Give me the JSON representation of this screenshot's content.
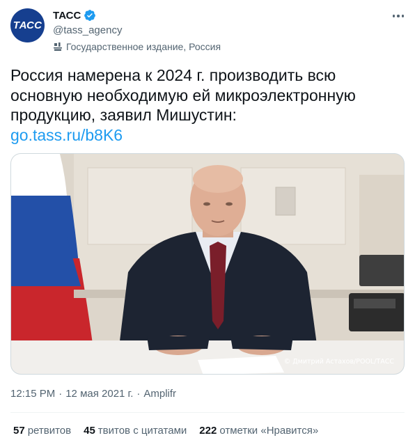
{
  "author": {
    "avatar_text": "ТАСС",
    "display_name": "ТАСС",
    "handle": "@tass_agency",
    "label": "Государственное издание, Россия",
    "verified": true
  },
  "icons": {
    "verified": "verified-badge-icon",
    "label": "state-media-icon",
    "more": "more-options-icon"
  },
  "tweet": {
    "text_lines": [
      "Россия намерена к 2024 г. производить всю",
      "основную необходимую ей микроэлектронную",
      "продукцию, заявил Мишустин:"
    ],
    "link": "go.tass.ru/b8K6",
    "photo_credit": "© Дмитрий Астахов/POOL/ТАСС"
  },
  "meta": {
    "time": "12:15 PM",
    "separator": "·",
    "date": "12 мая 2021 г.",
    "source": "Amplifr"
  },
  "stats": [
    {
      "count": "57",
      "label": "ретвитов"
    },
    {
      "count": "45",
      "label": "твитов с цитатами"
    },
    {
      "count": "222",
      "label": "отметки «Нравится»"
    }
  ],
  "colors": {
    "accent": "#1d9bf0",
    "avatar_bg": "#163f8f",
    "secondary_text": "#536471"
  }
}
